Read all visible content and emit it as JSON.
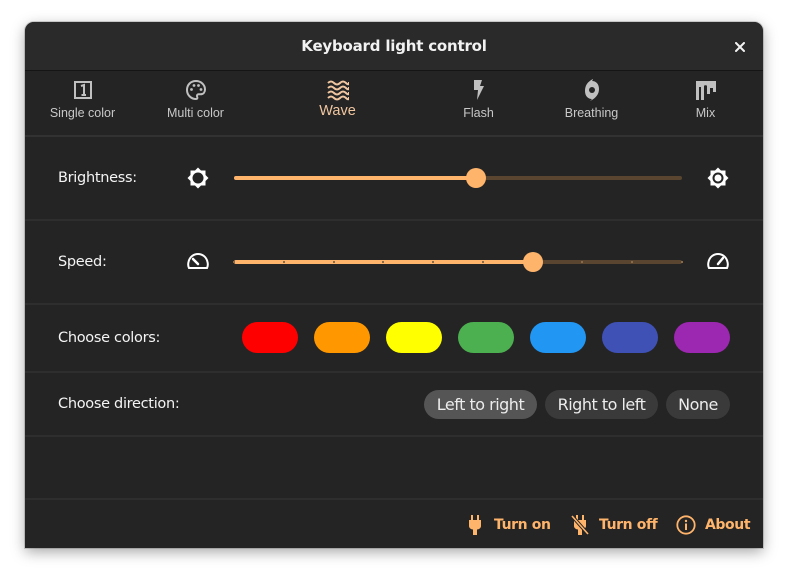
{
  "window": {
    "title": "Keyboard light control",
    "close_icon": "close-icon"
  },
  "tabs": [
    {
      "label": "Single color",
      "icon": "single-color-icon",
      "active": false
    },
    {
      "label": "Multi color",
      "icon": "palette-icon",
      "active": false
    },
    {
      "label": "Wave",
      "icon": "wave-icon",
      "active": true
    },
    {
      "label": "Flash",
      "icon": "flash-icon",
      "active": false
    },
    {
      "label": "Breathing",
      "icon": "breathing-icon",
      "active": false
    },
    {
      "label": "Mix",
      "icon": "mix-icon",
      "active": false
    }
  ],
  "brightness": {
    "label": "Brightness:",
    "value_fraction": 0.54,
    "min_icon": "brightness-low-icon",
    "max_icon": "brightness-high-icon"
  },
  "speed": {
    "label": "Speed:",
    "steps": 9,
    "value_step": 6,
    "min_icon": "speed-slow-icon",
    "max_icon": "speed-fast-icon"
  },
  "colors": {
    "label": "Choose colors:",
    "swatches": [
      {
        "name": "red",
        "hex": "#ff0000"
      },
      {
        "name": "orange",
        "hex": "#ff9800"
      },
      {
        "name": "yellow",
        "hex": "#ffff00"
      },
      {
        "name": "green",
        "hex": "#4caf50"
      },
      {
        "name": "blue",
        "hex": "#2196f3"
      },
      {
        "name": "indigo",
        "hex": "#3f51b5"
      },
      {
        "name": "purple",
        "hex": "#9c27b0"
      }
    ]
  },
  "direction": {
    "label": "Choose direction:",
    "options": [
      {
        "label": "Left to right",
        "selected": true
      },
      {
        "label": "Right to left",
        "selected": false
      },
      {
        "label": "None",
        "selected": false
      }
    ]
  },
  "footer": {
    "turn_on": "Turn on",
    "turn_off": "Turn off",
    "about": "About"
  },
  "theme": {
    "accent": "#ffb46b",
    "active_tab_text": "#f0c6a0",
    "background": "#242424"
  }
}
